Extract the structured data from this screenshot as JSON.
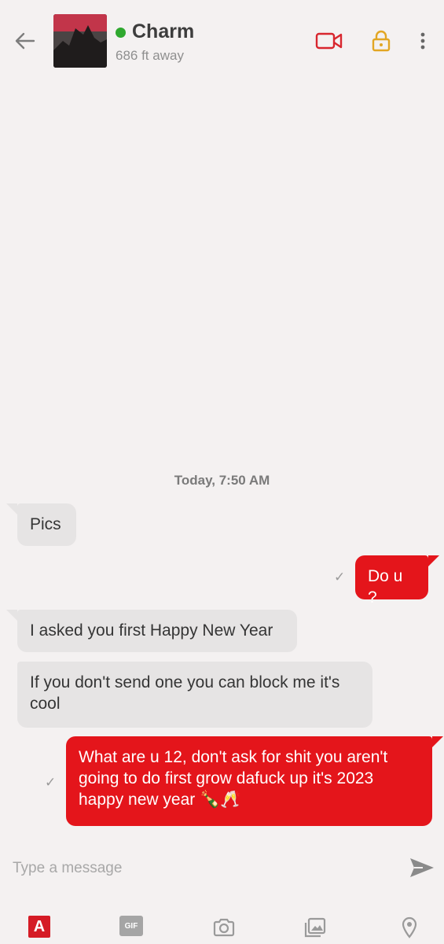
{
  "header": {
    "name": "Charm",
    "distance": "686 ft away",
    "online_color": "#2fa82f",
    "icons": [
      "back-arrow-icon",
      "video-call-icon",
      "lock-icon",
      "more-vertical-icon"
    ]
  },
  "thread": {
    "timestamp": "Today, 7:50 AM",
    "messages": [
      {
        "from": "them",
        "text": "Pics"
      },
      {
        "from": "me",
        "text": "Do u ?",
        "status": "✓"
      },
      {
        "from": "them",
        "text": "I asked you first Happy New Year"
      },
      {
        "from": "them",
        "text": "If you don't send one you can block me it's cool"
      },
      {
        "from": "me",
        "text": "What are u 12, don't ask for shit you aren't going to do first grow dafuck up it's 2023 happy new year 🍾🥂",
        "status": "✓"
      }
    ]
  },
  "composer": {
    "placeholder": "Type a message",
    "send_icon": "send-icon"
  },
  "toolbar": {
    "text_style_label": "A",
    "gif_label": "GIF",
    "icons": [
      "text-style-icon",
      "gif-icon",
      "camera-icon",
      "gallery-icon",
      "location-pin-icon"
    ]
  },
  "colors": {
    "accent": "#e4151b",
    "incoming_bubble": "#e6e4e4",
    "background": "#f4f1f1"
  }
}
